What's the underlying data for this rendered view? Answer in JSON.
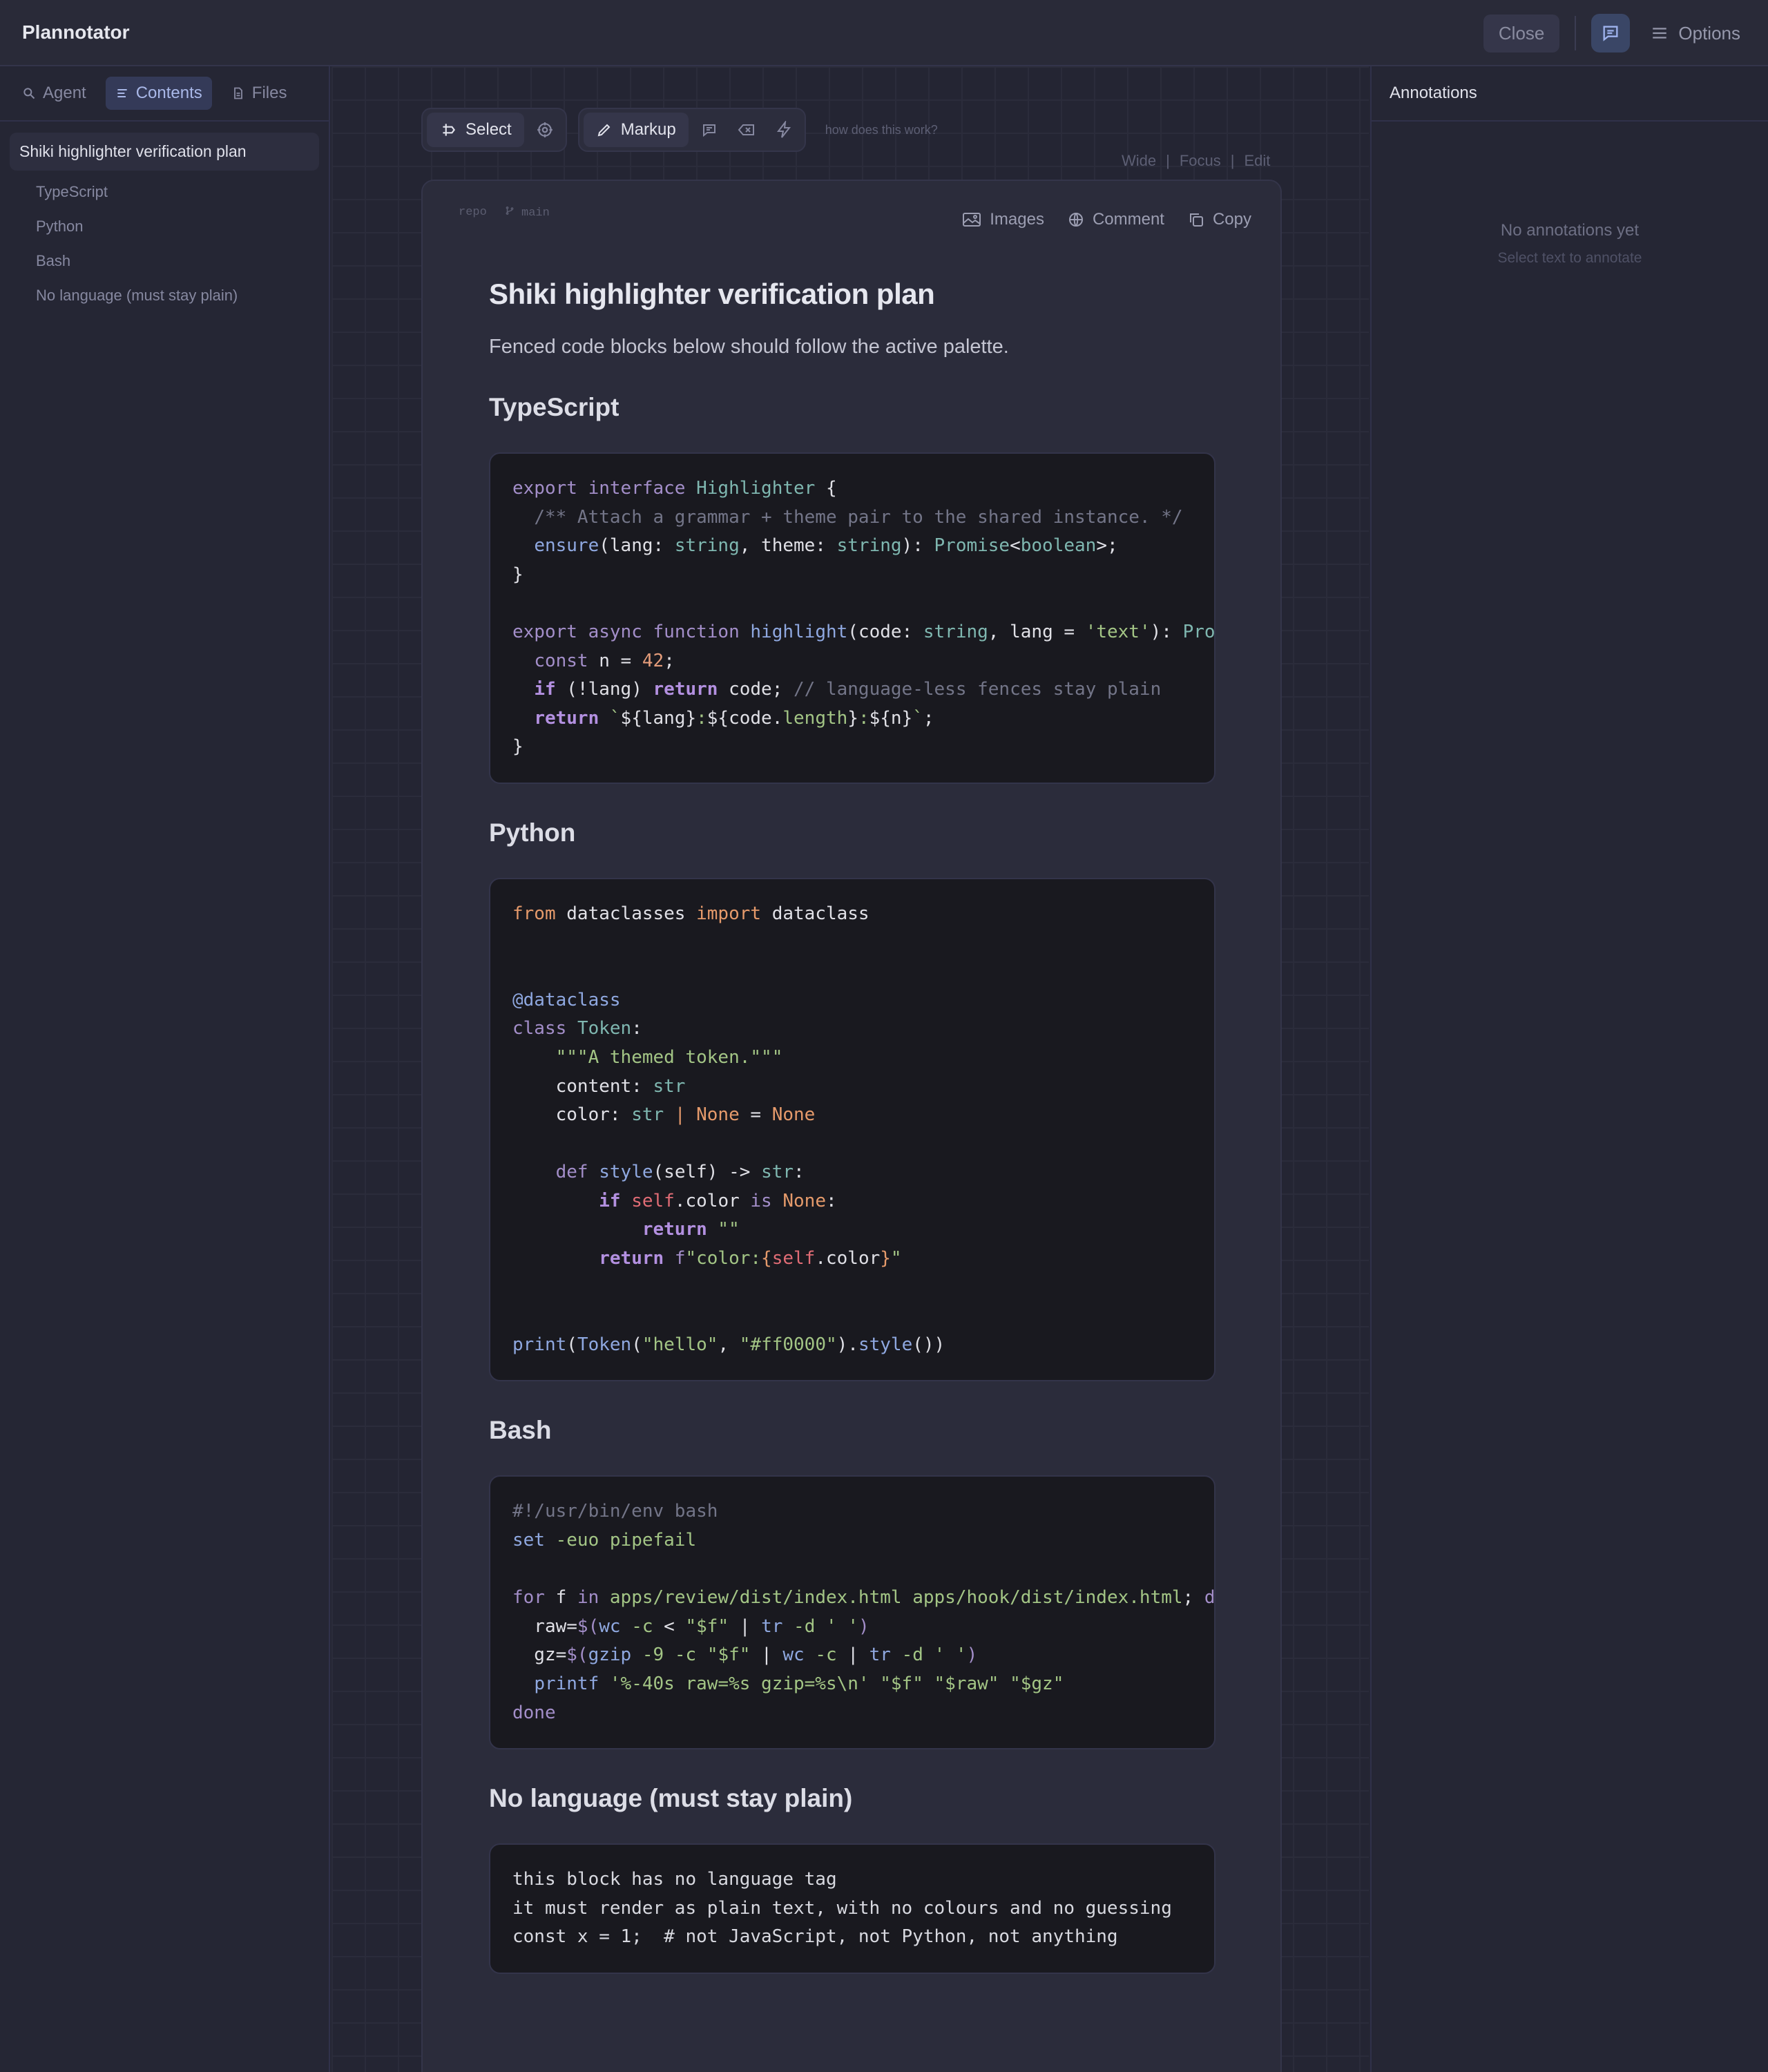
{
  "app": {
    "title": "Plannotator"
  },
  "topbar": {
    "close_label": "Close",
    "options_label": "Options"
  },
  "sidebar": {
    "tabs": [
      {
        "label": "Agent",
        "icon": "search-icon"
      },
      {
        "label": "Contents",
        "icon": "list-icon",
        "active": true
      },
      {
        "label": "Files",
        "icon": "file-icon"
      }
    ],
    "toc": [
      "Shiki highlighter verification plan",
      "TypeScript",
      "Python",
      "Bash",
      "No language (must stay plain)"
    ]
  },
  "toolbar": {
    "select_label": "Select",
    "markup_label": "Markup",
    "help_link": "how does this work?",
    "view_options": [
      "Wide",
      "|",
      "Focus",
      "|",
      "Edit"
    ]
  },
  "doc": {
    "meta": {
      "repo": "repo",
      "branch": "main"
    },
    "actions": {
      "images": "Images",
      "comment": "Comment",
      "copy": "Copy"
    },
    "title": "Shiki highlighter verification plan",
    "lead": "Fenced code blocks below should follow the active palette.",
    "sections": {
      "typescript": "TypeScript",
      "python": "Python",
      "bash": "Bash",
      "plain": "No language (must stay plain)"
    },
    "plain_code": "this block has no language tag\nit must render as plain text, with no colours and no guessing\nconst x = 1;  # not JavaScript, not Python, not anything"
  },
  "annotations": {
    "title": "Annotations",
    "empty_title": "No annotations yet",
    "empty_hint": "Select text to annotate"
  },
  "colors": {
    "accent": "#a9b8e8",
    "keyword": "#a38ec9",
    "string": "#a3c585",
    "type": "#7fb7b0",
    "comment": "#737588",
    "number": "#e49c7a"
  }
}
